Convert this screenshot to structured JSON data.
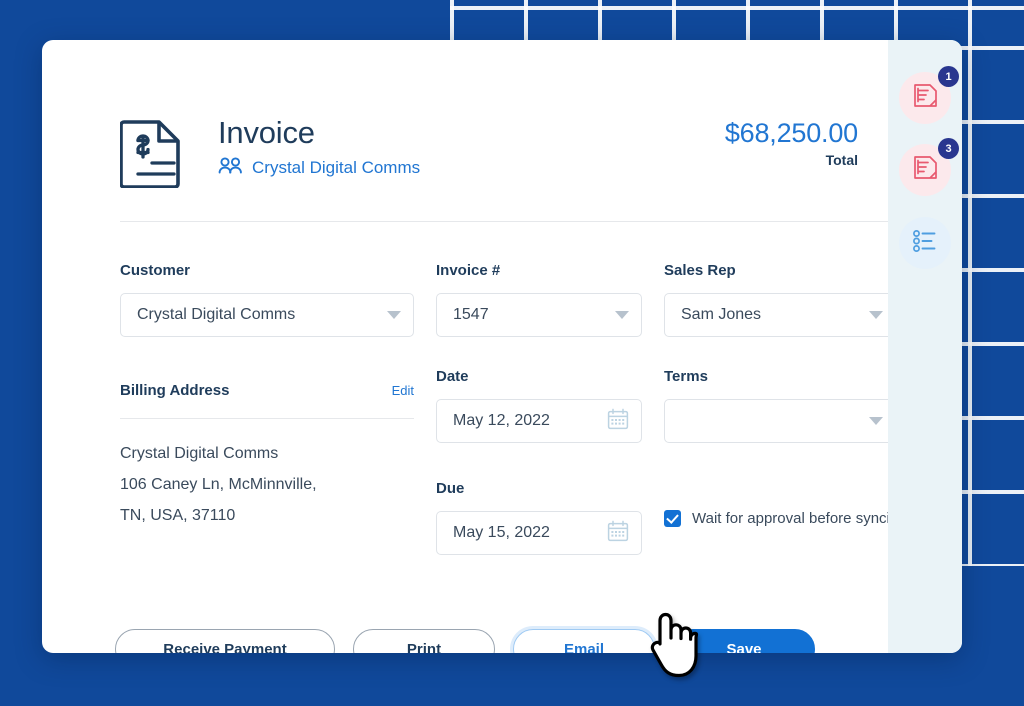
{
  "window": {
    "background_color": "#10499b",
    "grid_line_color": "#ffffff"
  },
  "header": {
    "doc_icon": "invoice-document-icon",
    "title": "Invoice",
    "people_icon": "people-icon",
    "customer_link": "Crystal Digital Comms",
    "total_amount": "$68,250.00",
    "total_label": "Total",
    "accent_color": "#2176d2",
    "title_color": "#1f3c5b"
  },
  "form": {
    "customer": {
      "label": "Customer",
      "value": "Crystal Digital Comms",
      "type": "select"
    },
    "invoice_number": {
      "label": "Invoice #",
      "value": "1547",
      "type": "select"
    },
    "sales_rep": {
      "label": "Sales Rep",
      "value": "Sam Jones",
      "type": "select"
    },
    "billing_address": {
      "label": "Billing Address",
      "edit_label": "Edit",
      "lines": [
        "Crystal Digital Comms",
        "106 Caney Ln, McMinnville,",
        "TN, USA, 37110"
      ]
    },
    "date": {
      "label": "Date",
      "value": "May 12, 2022",
      "icon": "calendar-icon",
      "type": "date"
    },
    "due": {
      "label": "Due",
      "value": "May 15, 2022",
      "icon": "calendar-icon",
      "type": "date"
    },
    "terms": {
      "label": "Terms",
      "value": "",
      "type": "select"
    },
    "wait_for_approval": {
      "label": "Wait for approval before syncing",
      "checked": true,
      "checkbox_color": "#1271d4"
    }
  },
  "footer": {
    "receive_payment_label": "Receive Payment",
    "print_label": "Print",
    "email_label": "Email",
    "save_label": "Save",
    "save_color": "#1271d4",
    "email_focus_color": "#9fcaf3"
  },
  "sidebar": {
    "background_color": "#eaf3f7",
    "items": [
      {
        "icon": "note-edit-icon",
        "badge": "1",
        "style": "pink",
        "badge_color": "#29368f"
      },
      {
        "icon": "note-edit-icon",
        "badge": "3",
        "style": "pink",
        "badge_color": "#29368f"
      },
      {
        "icon": "checklist-icon",
        "badge": "",
        "style": "blue",
        "badge_color": ""
      }
    ]
  },
  "cursor": {
    "icon": "pointing-hand-cursor"
  }
}
